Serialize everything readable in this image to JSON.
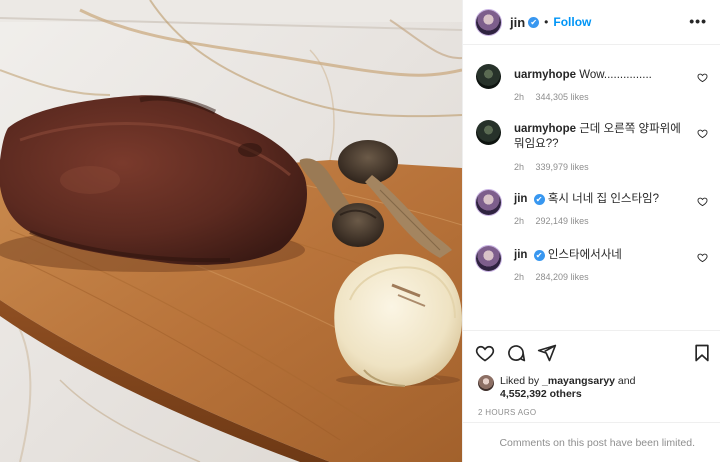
{
  "header": {
    "username": "jin",
    "verified_mark": "✔",
    "separator": "•",
    "follow_label": "Follow",
    "more_icon": "more-horizontal-icon",
    "more_label": "•••"
  },
  "comments": [
    {
      "username": "uarmyhope",
      "verified": false,
      "text": "Wow...............",
      "time": "2h",
      "likes": "344,305 likes"
    },
    {
      "username": "uarmyhope",
      "verified": false,
      "text": "근데 오른쪽 양파위에 뭐임요??",
      "time": "2h",
      "likes": "339,979 likes"
    },
    {
      "username": "jin",
      "verified": true,
      "text": "혹시 너네 집 인스타임?",
      "time": "2h",
      "likes": "292,149 likes"
    },
    {
      "username": "jin",
      "verified": true,
      "text": "인스타에서사네",
      "time": "2h",
      "likes": "284,209 likes"
    }
  ],
  "actions": {
    "icons": [
      "heart-icon",
      "comment-icon",
      "share-icon",
      "bookmark-icon"
    ],
    "liked_by_prefix": "Liked by",
    "liked_by_user": "_mayangsaryy",
    "liked_by_and": "and",
    "liked_by_count": "4,552,392 others",
    "timestamp": "2 HOURS AGO"
  },
  "footer": {
    "notice": "Comments on this post have been limited."
  },
  "colors": {
    "accent": "#0095f6",
    "verified": "#3897f0",
    "meta_text": "#8e8e8e",
    "divider": "#efefef"
  }
}
